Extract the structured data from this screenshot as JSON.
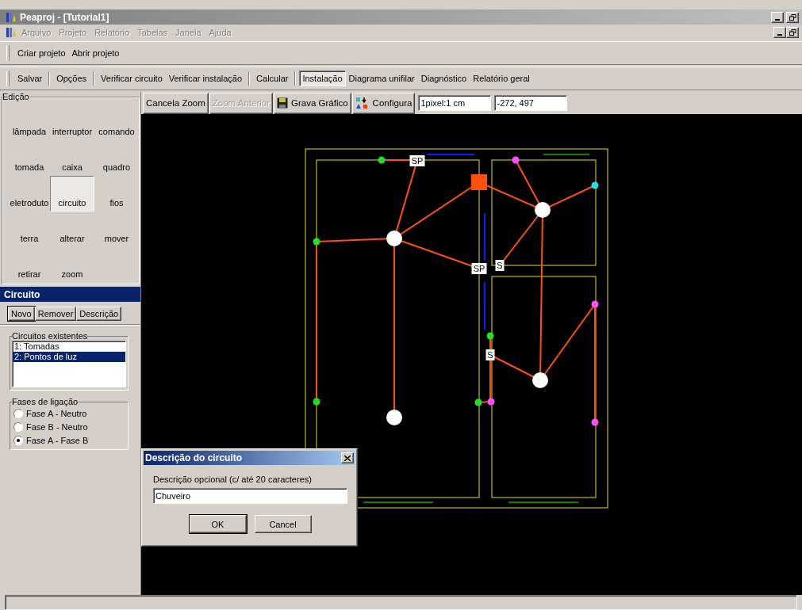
{
  "window": {
    "title": "Peaproj - [Tutorial1]"
  },
  "menu": [
    {
      "label": "Arquivo",
      "disabled": true
    },
    {
      "label": "Projeto",
      "disabled": true
    },
    {
      "label": "Relatório",
      "disabled": true
    },
    {
      "label": "Tabelas",
      "disabled": true
    },
    {
      "label": "Janela",
      "disabled": true
    },
    {
      "label": "Ajuda",
      "disabled": true
    }
  ],
  "project_toolbar": {
    "items": [
      {
        "label": "Criar projeto"
      },
      {
        "label": "Abrir projeto"
      }
    ]
  },
  "main_toolbar": {
    "groups": [
      [
        {
          "label": "Salvar",
          "selected": false
        }
      ],
      [
        {
          "label": "Opções",
          "selected": false
        }
      ],
      [
        {
          "label": "Verificar circuito",
          "selected": false
        },
        {
          "label": "Verificar instalação",
          "selected": false
        }
      ],
      [
        {
          "label": "Calcular",
          "selected": false
        }
      ],
      [
        {
          "label": "Instalação",
          "selected": true
        },
        {
          "label": "Diagrama unifilar",
          "selected": false
        },
        {
          "label": "Diagnóstico",
          "selected": false
        },
        {
          "label": "Relatório geral",
          "selected": false
        }
      ]
    ]
  },
  "edit_panel": {
    "title": "Edição",
    "tools": [
      {
        "label": "lâmpada",
        "selected": false
      },
      {
        "label": "interruptor",
        "selected": false
      },
      {
        "label": "comando",
        "selected": false
      },
      {
        "label": "tomada",
        "selected": false
      },
      {
        "label": "caixa",
        "selected": false
      },
      {
        "label": "quadro",
        "selected": false
      },
      {
        "label": "eletroduto",
        "selected": false
      },
      {
        "label": "circuito",
        "selected": true
      },
      {
        "label": "fios",
        "selected": false
      },
      {
        "label": "terra",
        "selected": false
      },
      {
        "label": "alterar",
        "selected": false
      },
      {
        "label": "mover",
        "selected": false
      },
      {
        "label": "retirar",
        "selected": false
      },
      {
        "label": "zoom",
        "selected": false
      }
    ]
  },
  "circuit_panel": {
    "header": "Circuito",
    "buttons": [
      {
        "label": "Novo",
        "focused": true
      },
      {
        "label": "Remover",
        "focused": false
      },
      {
        "label": "Descrição",
        "focused": false
      }
    ],
    "existing": {
      "title": "Circuitos existentes",
      "items": [
        {
          "label": "1: Tomadas",
          "selected": false
        },
        {
          "label": "2: Pontos de luz",
          "selected": true
        }
      ]
    },
    "phases": {
      "title": "Fases de ligação",
      "options": [
        {
          "label": "Fase A - Neutro",
          "selected": false
        },
        {
          "label": "Fase B - Neutro",
          "selected": false
        },
        {
          "label": "Fase A - Fase B",
          "selected": true
        }
      ]
    }
  },
  "canvas_toolbar": {
    "buttons": [
      {
        "label": "Cancela Zoom",
        "kind": "text",
        "disabled": false
      },
      {
        "label": "Zoom Anterior",
        "kind": "text",
        "disabled": true
      },
      {
        "label": "Grava Gráfico",
        "kind": "save",
        "disabled": false
      },
      {
        "label": "Configura",
        "kind": "config",
        "disabled": false
      }
    ],
    "fields": [
      {
        "value": "1pixel:1 cm"
      },
      {
        "value": "-272, 497"
      }
    ]
  },
  "canvas": {
    "labels": [
      {
        "text": "SP"
      },
      {
        "text": "SP"
      },
      {
        "text": "S"
      },
      {
        "text": "S"
      }
    ]
  },
  "dialog": {
    "title": "Descrição do circuito",
    "prompt": "Descrição opcional (c/ até 20 caracteres)",
    "value": "Chuveiro",
    "buttons": [
      {
        "label": "OK",
        "focused": true
      },
      {
        "label": "Cancel",
        "focused": false
      }
    ]
  }
}
